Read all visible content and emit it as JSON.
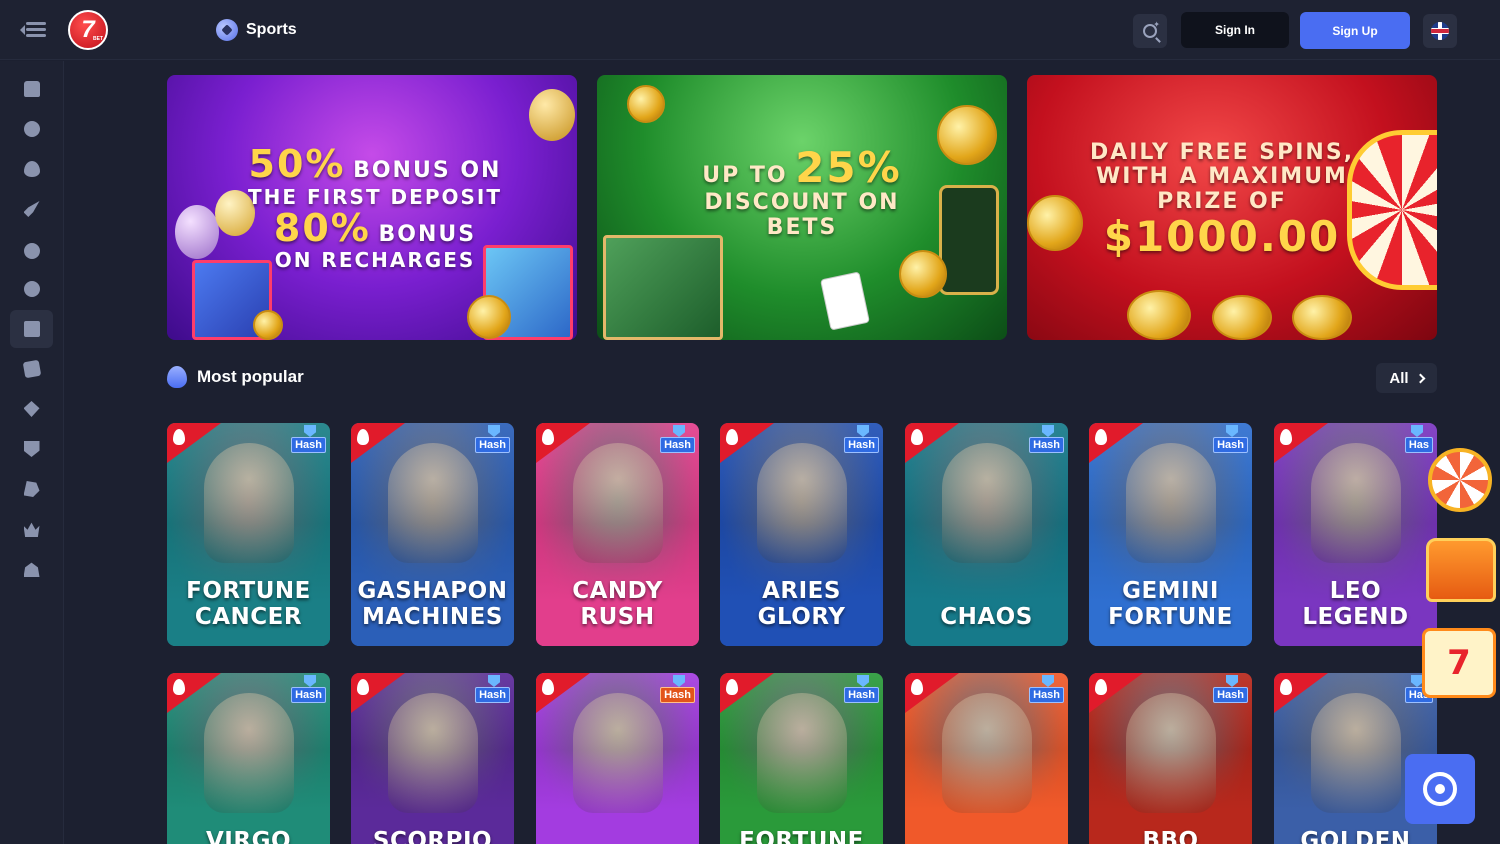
{
  "header": {
    "logo_text": "7",
    "logo_sub": "BET",
    "nav": {
      "sports_label": "Sports"
    },
    "signin_label": "Sign In",
    "signup_label": "Sign Up",
    "language_icon": "uk-flag-icon",
    "search_icon": "search-sparkle-icon",
    "menu_icon": "menu-collapse-icon"
  },
  "sidebar": {
    "items": [
      {
        "icon": "chest-icon"
      },
      {
        "icon": "clock-icon"
      },
      {
        "icon": "fire-icon"
      },
      {
        "icon": "rocket-icon"
      },
      {
        "icon": "soccer-ball-icon"
      },
      {
        "icon": "basketball-icon"
      },
      {
        "icon": "slot-machine-icon",
        "active": true
      },
      {
        "icon": "cards-icon"
      },
      {
        "icon": "poker-chip-icon"
      },
      {
        "icon": "shield-icon"
      },
      {
        "icon": "horse-icon"
      },
      {
        "icon": "crown-icon"
      },
      {
        "icon": "fishing-icon"
      }
    ]
  },
  "banners": [
    {
      "line1_big": "50%",
      "line1_small": "BONUS ON",
      "line2": "THE FIRST DEPOSIT",
      "line3_big": "80%",
      "line3_small": "BONUS",
      "line4": "ON RECHARGES"
    },
    {
      "line1_small": "UP TO",
      "line1_big": "25%",
      "line2": "DISCOUNT ON",
      "line3": "BETS"
    },
    {
      "line1": "DAILY FREE SPINS,",
      "line2": "WITH A MAXIMUM",
      "line3": "PRIZE OF",
      "amount": "$1000.00"
    }
  ],
  "section": {
    "title": "Most popular",
    "all_label": "All"
  },
  "games_row1": [
    {
      "name": "FORTUNE\nCANCER",
      "tag": "Hash",
      "bg": "#1a7f86"
    },
    {
      "name": "GASHAPON\nMACHINES",
      "tag": "Hash",
      "bg": "#2b5fb8"
    },
    {
      "name": "CANDY\nRUSH",
      "tag": "Hash",
      "bg": "#e23e8c"
    },
    {
      "name": "ARIES\nGLORY",
      "tag": "Hash",
      "bg": "#2050b5"
    },
    {
      "name": "CHAOS",
      "tag": "Hash",
      "bg": "#167a8a"
    },
    {
      "name": "GEMINI\nFORTUNE",
      "tag": "Hash",
      "bg": "#2f6fd0"
    },
    {
      "name": "LEO\nLEGEND",
      "tag": "Has",
      "bg": "#7a36c0"
    }
  ],
  "games_row2": [
    {
      "name": "VIRGO",
      "tag": "Hash",
      "bg": "#1f8c78"
    },
    {
      "name": "SCORPIO",
      "tag": "Hash",
      "bg": "#5b2a9a"
    },
    {
      "name": "",
      "tag": "Hash",
      "bg": "#a33ce0"
    },
    {
      "name": "FORTUNE",
      "tag": "Hash",
      "bg": "#2a9a3a"
    },
    {
      "name": "",
      "tag": "Hash",
      "bg": "#f0592a"
    },
    {
      "name": "BBQ",
      "tag": "Hash",
      "bg": "#b8281c"
    },
    {
      "name": "GOLDEN",
      "tag": "Has",
      "bg": "#3b5fa8"
    }
  ],
  "widgets": {
    "calendar_number": "7"
  },
  "colors": {
    "accent": "#4a6df2",
    "background": "#1c2030",
    "panel": "#1e2232"
  }
}
